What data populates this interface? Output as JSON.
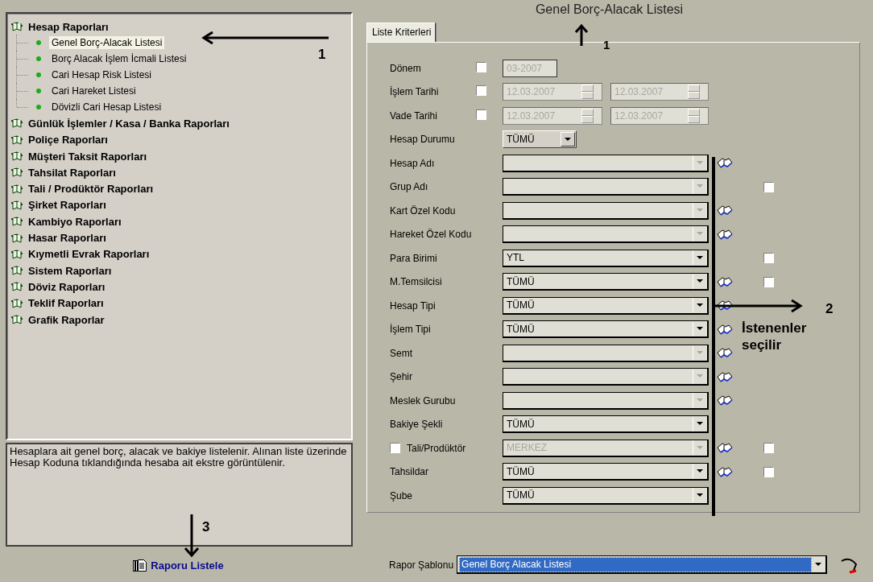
{
  "tree": [
    {
      "label": "Hesap Raporları",
      "children": [
        {
          "label": "Genel Borç-Alacak Listesi",
          "selected": true
        },
        {
          "label": "Borç Alacak İşlem İcmali Listesi",
          "selected": false
        },
        {
          "label": "Cari Hesap Risk Listesi",
          "selected": false
        },
        {
          "label": "Cari Hareket Listesi",
          "selected": false
        },
        {
          "label": "Dövizli Cari Hesap Listesi",
          "selected": false
        }
      ]
    },
    {
      "label": "Günlük İşlemler / Kasa / Banka Raporları"
    },
    {
      "label": "Poliçe Raporları"
    },
    {
      "label": "Müşteri Taksit Raporları"
    },
    {
      "label": "Tahsilat Raporları"
    },
    {
      "label": "Tali / Prodüktör Raporları"
    },
    {
      "label": "Şirket Raporları"
    },
    {
      "label": "Kambiyo Raporları"
    },
    {
      "label": "Hasar Raporları"
    },
    {
      "label": "Kıymetli Evrak Raporları"
    },
    {
      "label": "Sistem Raporları"
    },
    {
      "label": "Döviz Raporları"
    },
    {
      "label": "Teklif Raporları"
    },
    {
      "label": "Grafik Raporlar"
    }
  ],
  "description": "Hesaplara ait genel borç, alacak ve bakiye listelenir. Alınan liste üzerinde Hesap Koduna tıklandığında hesaba ait ekstre görüntülenir.",
  "list_button": "Raporu Listele",
  "report_title": "Genel Borç-Alacak Listesi",
  "tabs": [
    {
      "label": "Liste Kriterleri",
      "selected": true
    }
  ],
  "criteria": [
    {
      "kind": "period",
      "label": "Dönem",
      "checked": false,
      "disabled": true,
      "value": "03-2007"
    },
    {
      "kind": "dates",
      "label": "İşlem Tarihi",
      "checked": false,
      "disabled": true,
      "from": "12.03.2007",
      "to": "12.03.2007"
    },
    {
      "kind": "dates",
      "label": "Vade Tarihi",
      "checked": false,
      "disabled": true,
      "from": "12.03.2007",
      "to": "12.03.2007"
    },
    {
      "kind": "short_combo",
      "label": "Hesap Durumu",
      "value": "TÜMÜ"
    },
    {
      "kind": "combo",
      "label": "Hesap Adı",
      "disabled": true,
      "lookup": true
    },
    {
      "kind": "combo",
      "label": "Grup Adı",
      "disabled": true,
      "option_checked": false
    },
    {
      "kind": "combo",
      "label": "Kart Özel Kodu",
      "disabled": true,
      "lookup": true
    },
    {
      "kind": "combo",
      "label": "Hareket Özel Kodu",
      "disabled": true,
      "lookup": true
    },
    {
      "kind": "combo",
      "label": "Para Birimi",
      "value": "YTL",
      "disabled": false,
      "option_checked": false
    },
    {
      "kind": "combo",
      "label": "M.Temsilcisi",
      "value": "TÜMÜ",
      "disabled": false,
      "lookup": true,
      "option_checked": false
    },
    {
      "kind": "combo",
      "label": "Hesap Tipi",
      "value": "TÜMÜ",
      "disabled": false,
      "lookup": true
    },
    {
      "kind": "combo",
      "label": "İşlem Tipi",
      "value": "TÜMÜ",
      "disabled": false,
      "lookup": true
    },
    {
      "kind": "combo",
      "label": "Semt",
      "disabled": true,
      "lookup": true
    },
    {
      "kind": "combo",
      "label": "Şehir",
      "disabled": true,
      "lookup": true
    },
    {
      "kind": "combo",
      "label": "Meslek Gurubu",
      "disabled": true,
      "lookup": true
    },
    {
      "kind": "combo",
      "label": "Bakiye  Şekli",
      "value": "TÜMÜ",
      "disabled": false
    },
    {
      "kind": "combo",
      "label": "Tali/Prodüktör",
      "checked": false,
      "value": "MERKEZ",
      "disabled": true,
      "lookup": true,
      "option_checked": false
    },
    {
      "kind": "combo",
      "label": "Tahsildar",
      "value": "TÜMÜ",
      "disabled": false,
      "lookup": true,
      "option_checked": false
    },
    {
      "kind": "combo",
      "label": "Şube",
      "value": "TÜMÜ",
      "disabled": false
    }
  ],
  "template": {
    "label": "Rapor Şablonu",
    "value": "Genel Borç Alacak Listesi"
  },
  "annotations": [
    {
      "kind": "left_arrow",
      "label": "1"
    },
    {
      "kind": "up_arrow",
      "label": "1"
    },
    {
      "kind": "right_arrow",
      "label": "2",
      "note": "İstenenler seçilir"
    },
    {
      "kind": "down_arrow",
      "label": "3"
    }
  ]
}
